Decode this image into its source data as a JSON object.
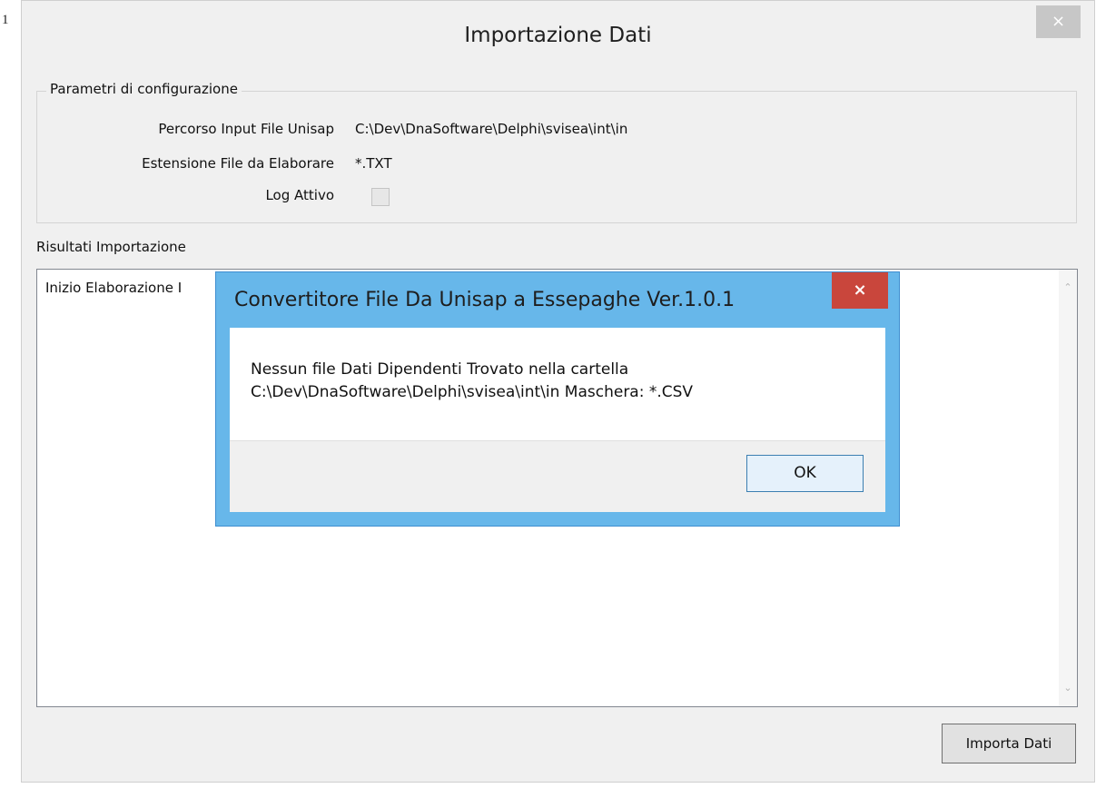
{
  "background": {
    "glyph": "1"
  },
  "main_window": {
    "title": "Importazione Dati",
    "close_label": "×",
    "config_group": {
      "title": "Parametri di configurazione",
      "input_path_label": "Percorso Input File Unisap",
      "input_path_value": "C:\\Dev\\DnaSoftware\\Delphi\\svisea\\int\\in",
      "extension_label": "Estensione File da Elaborare",
      "extension_value": "*.TXT",
      "log_label": "Log Attivo",
      "log_checked": false
    },
    "results_label": "Risultati Importazione",
    "results_text": "Inizio Elaborazione I",
    "scroll_up": "⌃",
    "scroll_down": "⌄",
    "import_button": "Importa Dati"
  },
  "message_box": {
    "title": "Convertitore File Da Unisap a Essepaghe Ver.1.0.1",
    "close_label": "×",
    "message_line1": "Nessun file Dati Dipendenti Trovato nella cartella",
    "message_line2": "C:\\Dev\\DnaSoftware\\Delphi\\svisea\\int\\in Maschera: *.CSV",
    "ok_button": "OK"
  },
  "colors": {
    "dialog_bg": "#f0f0f0",
    "msgbox_frame": "#67b7ea",
    "msgbox_close": "#c9463c",
    "ok_button_bg": "#e5f1fb"
  }
}
